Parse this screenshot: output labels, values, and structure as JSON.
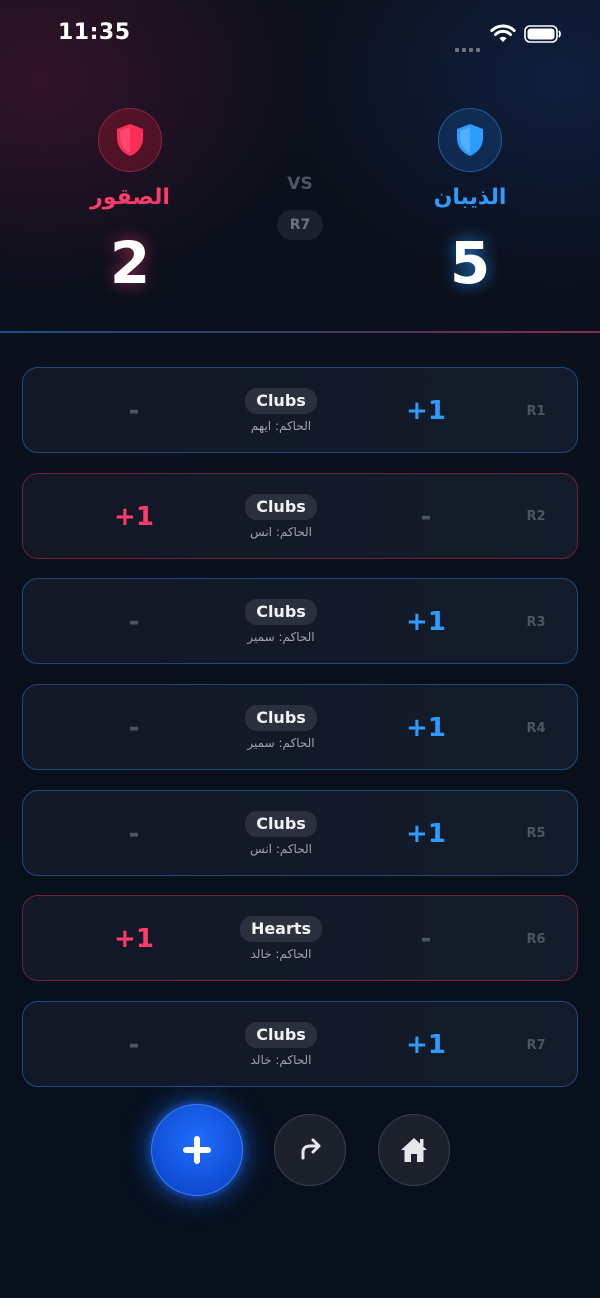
{
  "status_bar": {
    "time": "11:35"
  },
  "header": {
    "left_team": {
      "name": "الصقور",
      "score": "2",
      "color": "#ff3b6b"
    },
    "right_team": {
      "name": "الذيبان",
      "score": "5",
      "color": "#2e9bff"
    },
    "vs_label": "VS",
    "current_round": "R7"
  },
  "rounds": [
    {
      "round": "R1",
      "suit": "Clubs",
      "referee": "الحاكم: ايهم",
      "left_value": "-",
      "right_value": "+1",
      "winner": "right"
    },
    {
      "round": "R2",
      "suit": "Clubs",
      "referee": "الحاكم: انس",
      "left_value": "+1",
      "right_value": "-",
      "winner": "left"
    },
    {
      "round": "R3",
      "suit": "Clubs",
      "referee": "الحاكم: سمير",
      "left_value": "-",
      "right_value": "+1",
      "winner": "right"
    },
    {
      "round": "R4",
      "suit": "Clubs",
      "referee": "الحاكم: سمير",
      "left_value": "-",
      "right_value": "+1",
      "winner": "right"
    },
    {
      "round": "R5",
      "suit": "Clubs",
      "referee": "الحاكم: انس",
      "left_value": "-",
      "right_value": "+1",
      "winner": "right"
    },
    {
      "round": "R6",
      "suit": "Hearts",
      "referee": "الحاكم: خالد",
      "left_value": "+1",
      "right_value": "-",
      "winner": "left"
    },
    {
      "round": "R7",
      "suit": "Clubs",
      "referee": "الحاكم: خالد",
      "left_value": "-",
      "right_value": "+1",
      "winner": "right"
    }
  ],
  "controls": {
    "add_icon": "plus-icon",
    "redo_icon": "redo-arrow-icon",
    "home_icon": "home-icon",
    "accent": "#1f6dff"
  }
}
